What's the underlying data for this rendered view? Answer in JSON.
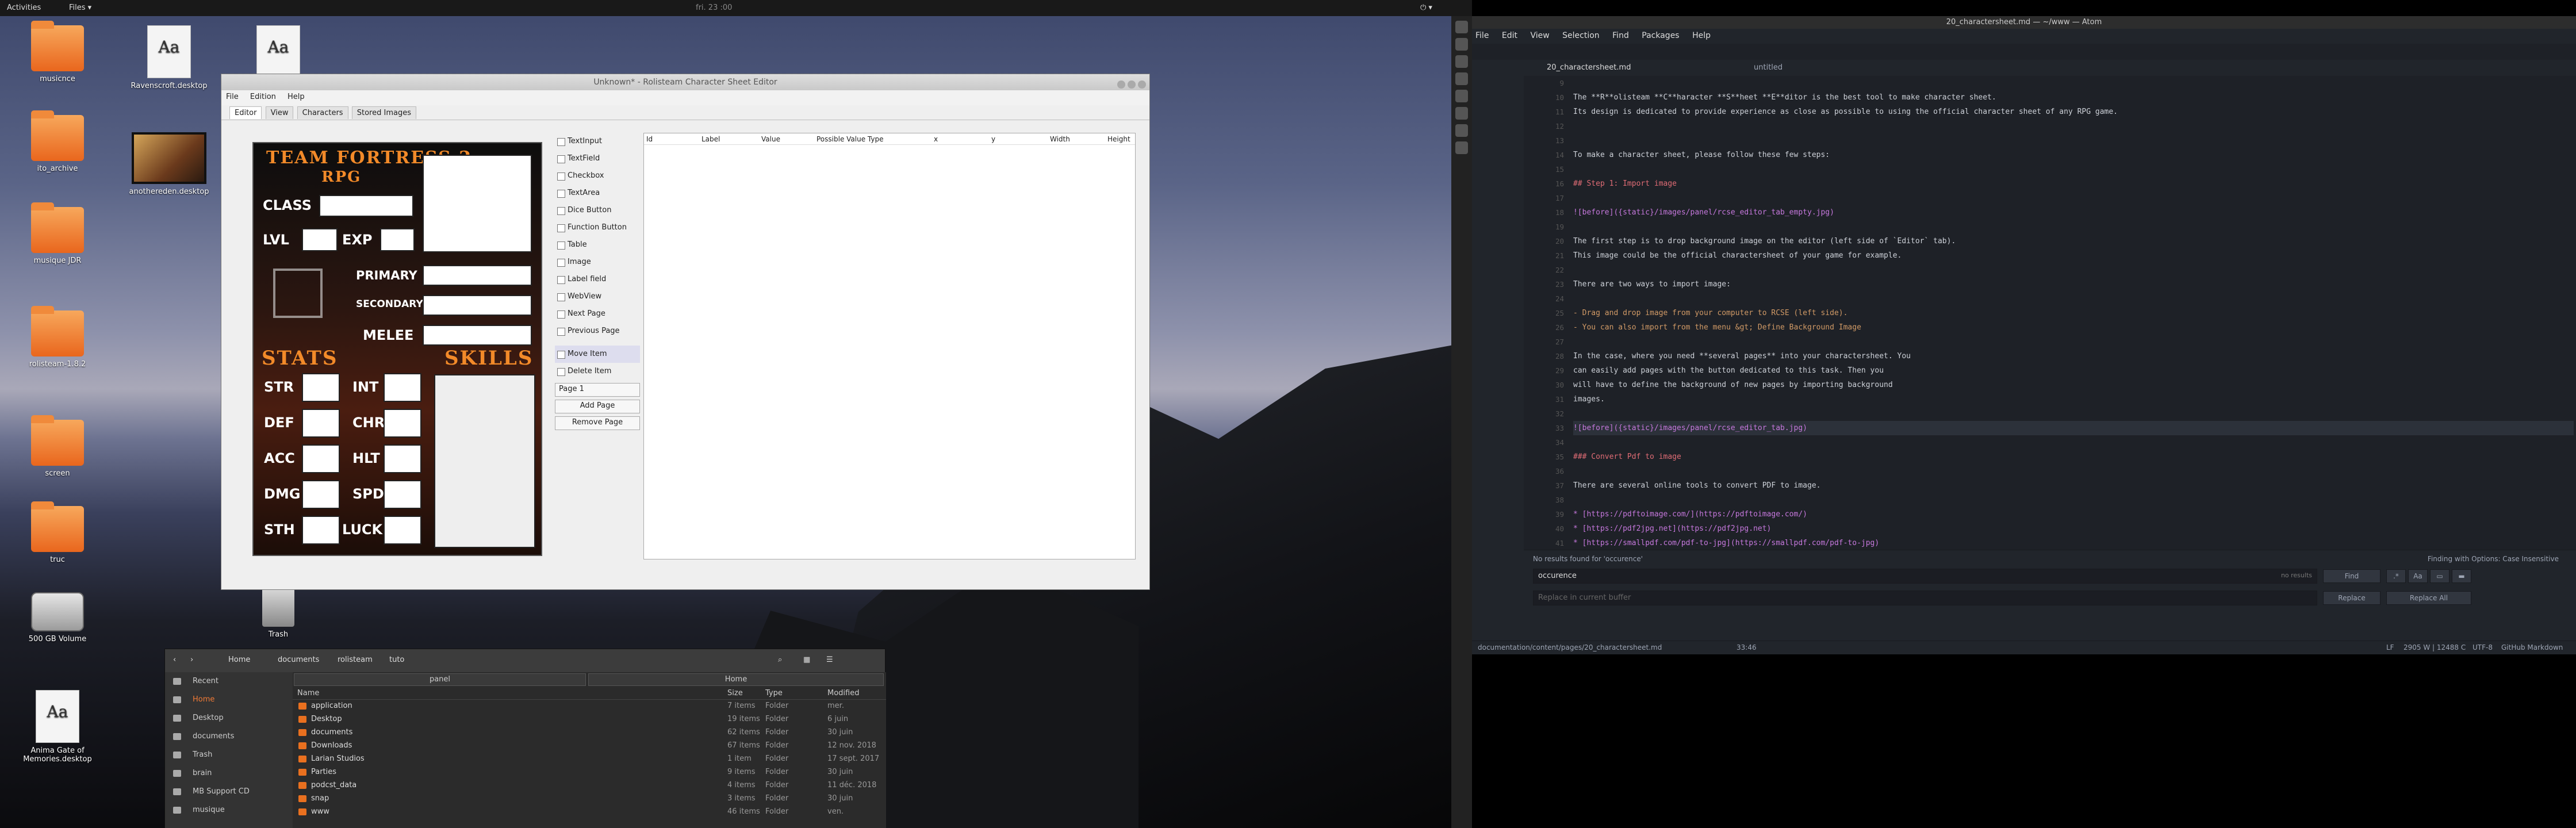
{
  "topbar": {
    "activities": "Activities",
    "app": "Files ▾",
    "clock": "fri. 23 :00"
  },
  "desktop": {
    "icons": [
      {
        "label": "musicnce",
        "type": "folder"
      },
      {
        "label": "ito_archive",
        "type": "folder"
      },
      {
        "label": "musique JDR",
        "type": "folder"
      },
      {
        "label": "rolisteam-1.8.2",
        "type": "folder"
      },
      {
        "label": "screen",
        "type": "folder"
      },
      {
        "label": "truc",
        "type": "folder"
      },
      {
        "label": "500 GB Volume",
        "type": "drive"
      },
      {
        "label": "Anima Gate of Memories.desktop",
        "type": "doc"
      },
      {
        "label": "Ravenscroft.desktop",
        "type": "doc"
      },
      {
        "label": "anothereden.desktop",
        "type": "doc"
      },
      {
        "label": "Trash",
        "type": "trash"
      }
    ]
  },
  "rcse": {
    "title": "Unknown* - Rolisteam Character Sheet Editor",
    "menu": [
      "File",
      "Edition",
      "Help"
    ],
    "tabs": [
      "Editor",
      "View",
      "Characters",
      "Stored Images"
    ],
    "sheet": {
      "title1": "TEAM FORTRESS 2",
      "title2": "RPG",
      "class": "CLASS",
      "lvl": "LVL",
      "exp": "EXP",
      "primary": "PRIMARY",
      "secondary": "SECONDARY",
      "melee": "MELEE",
      "stats": "STATS",
      "skills": "SKILLS",
      "str": "STR",
      "int": "INT",
      "def": "DEF",
      "chr": "CHR",
      "acc": "ACC",
      "hlt": "HLT",
      "dmg": "DMG",
      "spd": "SPD",
      "sth": "STH",
      "luck": "LUCK"
    },
    "tools": [
      "TextInput",
      "TextField",
      "Checkbox",
      "TextArea",
      "Dice Button",
      "Function Button",
      "Table",
      "Image",
      "Label field",
      "WebView",
      "Next Page",
      "Previous Page"
    ],
    "actions": {
      "move": "Move Item",
      "delete": "Delete Item",
      "page": "Page 1",
      "add": "Add Page",
      "remove": "Remove Page"
    },
    "columns": [
      "Id",
      "Label",
      "Value",
      "Possible Value Type",
      "x",
      "y",
      "Width",
      "Height"
    ]
  },
  "files": {
    "nav": [
      "Home",
      "documents",
      "rolisteam",
      "tuto"
    ],
    "sidebar": [
      "Recent",
      "Home",
      "Desktop",
      "documents",
      "Trash",
      "brain",
      "MB Support CD",
      "musique"
    ],
    "pane_left": "panel",
    "pane_right": "Home",
    "headers": [
      "Name",
      "Size",
      "Type",
      "Modified"
    ],
    "rows": [
      {
        "name": "application",
        "size": "7 items",
        "type": "Folder",
        "mod": "mer."
      },
      {
        "name": "Desktop",
        "size": "19 items",
        "type": "Folder",
        "mod": "6 juin"
      },
      {
        "name": "documents",
        "size": "62 items",
        "type": "Folder",
        "mod": "30 juin"
      },
      {
        "name": "Downloads",
        "size": "67 items",
        "type": "Folder",
        "mod": "12 nov. 2018"
      },
      {
        "name": "Larian Studios",
        "size": "1 item",
        "type": "Folder",
        "mod": "17 sept. 2017"
      },
      {
        "name": "Parties",
        "size": "9 items",
        "type": "Folder",
        "mod": "30 juin"
      },
      {
        "name": "podcst_data",
        "size": "4 items",
        "type": "Folder",
        "mod": "11 déc. 2018"
      },
      {
        "name": "snap",
        "size": "3 items",
        "type": "Folder",
        "mod": "30 juin"
      },
      {
        "name": "www",
        "size": "46 items",
        "type": "Folder",
        "mod": "ven."
      }
    ]
  },
  "atom": {
    "title": "20_charactersheet.md — ~/www — Atom",
    "menu": [
      "File",
      "Edit",
      "View",
      "Selection",
      "Find",
      "Packages",
      "Help"
    ],
    "tab1": "20_charactersheet.md",
    "tab2": "untitled",
    "lines": [
      {
        "n": "9",
        "t": ""
      },
      {
        "n": "10",
        "t": "The **R**olisteam **C**haracter **S**heet **E**ditor is the best tool to make character sheet."
      },
      {
        "n": "11",
        "t": "Its design is dedicated to provide experience as close as possible to using the official character sheet of any RPG game."
      },
      {
        "n": "12",
        "t": ""
      },
      {
        "n": "13",
        "t": ""
      },
      {
        "n": "14",
        "t": "To make a character sheet, please follow these few steps:"
      },
      {
        "n": "15",
        "t": ""
      },
      {
        "n": "16",
        "t": "## Step 1: Import image"
      },
      {
        "n": "17",
        "t": ""
      },
      {
        "n": "18",
        "t": "![before]({static}/images/panel/rcse_editor_tab_empty.jpg)"
      },
      {
        "n": "19",
        "t": ""
      },
      {
        "n": "20",
        "t": "The first step is to drop background image on the editor (left side of `Editor` tab)."
      },
      {
        "n": "21",
        "t": "This image could be the official charactersheet of your game for example."
      },
      {
        "n": "22",
        "t": ""
      },
      {
        "n": "23",
        "t": "There are two ways to import image:"
      },
      {
        "n": "24",
        "t": ""
      },
      {
        "n": "25",
        "t": "-  Drag and drop image from your computer to RCSE (left side)."
      },
      {
        "n": "26",
        "t": "-  You can also import from the menu &gt; Define Background Image"
      },
      {
        "n": "27",
        "t": ""
      },
      {
        "n": "28",
        "t": "In the case, where you need **several pages** into your charactersheet. You"
      },
      {
        "n": "29",
        "t": "can easily add pages with the button dedicated to this task. Then you"
      },
      {
        "n": "30",
        "t": "will have to define the background of new pages by importing background"
      },
      {
        "n": "31",
        "t": "images."
      },
      {
        "n": "32",
        "t": ""
      },
      {
        "n": "33",
        "t": "![before]({static}/images/panel/rcse_editor_tab.jpg)"
      },
      {
        "n": "34",
        "t": ""
      },
      {
        "n": "35",
        "t": "### Convert Pdf to image"
      },
      {
        "n": "36",
        "t": ""
      },
      {
        "n": "37",
        "t": "There are several online tools to convert PDF to image."
      },
      {
        "n": "38",
        "t": ""
      },
      {
        "n": "39",
        "t": "* [https://pdftoimage.com/](https://pdftoimage.com/)"
      },
      {
        "n": "40",
        "t": "* [https://pdf2jpg.net](https://pdf2jpg.net)"
      },
      {
        "n": "41",
        "t": "* [https://smallpdf.com/pdf-to-jpg](https://smallpdf.com/pdf-to-jpg)"
      }
    ],
    "find": {
      "status": "No results found for 'occurence'",
      "finding": "Finding with Options: Case Insensitive",
      "query": "occurence",
      "noresults": "no results",
      "replace_ph": "Replace in current buffer",
      "find_btn": "Find",
      "replace_btn": "Replace",
      "replace_all": "Replace All"
    },
    "statusbar": {
      "path": "documentation/content/pages/20_charactersheet.md",
      "pos": "33:46",
      "lf": "LF",
      "chars": "2905 W | 12488 C",
      "enc": "UTF-8",
      "grammar": "GitHub Markdown"
    }
  }
}
